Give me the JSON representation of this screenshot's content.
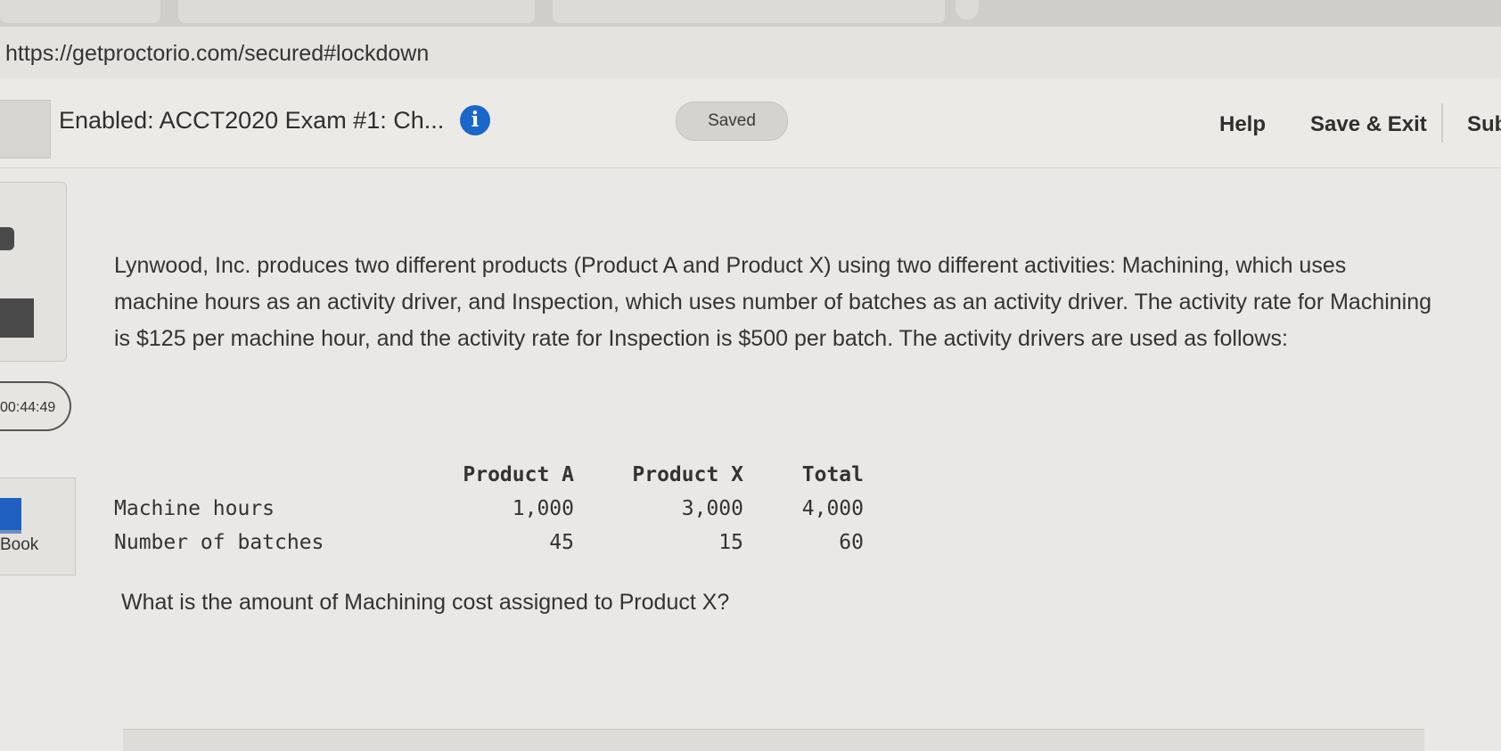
{
  "browser": {
    "url": "https://getproctorio.com/secured#lockdown"
  },
  "header": {
    "exam_title": "Enabled: ACCT2020 Exam #1: Ch...",
    "info_icon_glyph": "i",
    "saved_label": "Saved",
    "help_label": "Help",
    "save_exit_label": "Save & Exit",
    "submit_label": "Sub"
  },
  "sidebar": {
    "timer": "00:44:49",
    "ebook_label": "Book",
    "icons": [
      "calculator-icon",
      "book-icon"
    ]
  },
  "question": {
    "text": "Lynwood, Inc. produces two different products (Product A and Product X) using two different activities: Machining, which uses machine hours as an activity driver, and Inspection, which uses number of batches as an activity driver. The activity rate for Machining is $125 per machine hour, and the activity rate for Inspection is $500 per batch. The activity drivers are used as follows:",
    "table": {
      "headers": [
        "",
        "Product A",
        "Product X",
        "Total"
      ],
      "rows": [
        [
          "Machine hours",
          "1,000",
          "3,000",
          "4,000"
        ],
        [
          "Number of batches",
          "45",
          "15",
          "60"
        ]
      ]
    },
    "prompt": "What is the amount of Machining cost assigned to Product X?"
  },
  "colors": {
    "info_icon_bg": "#1a66c9",
    "ebook_icon": "#1f5fbf",
    "page_bg": "#e9e8e6"
  }
}
